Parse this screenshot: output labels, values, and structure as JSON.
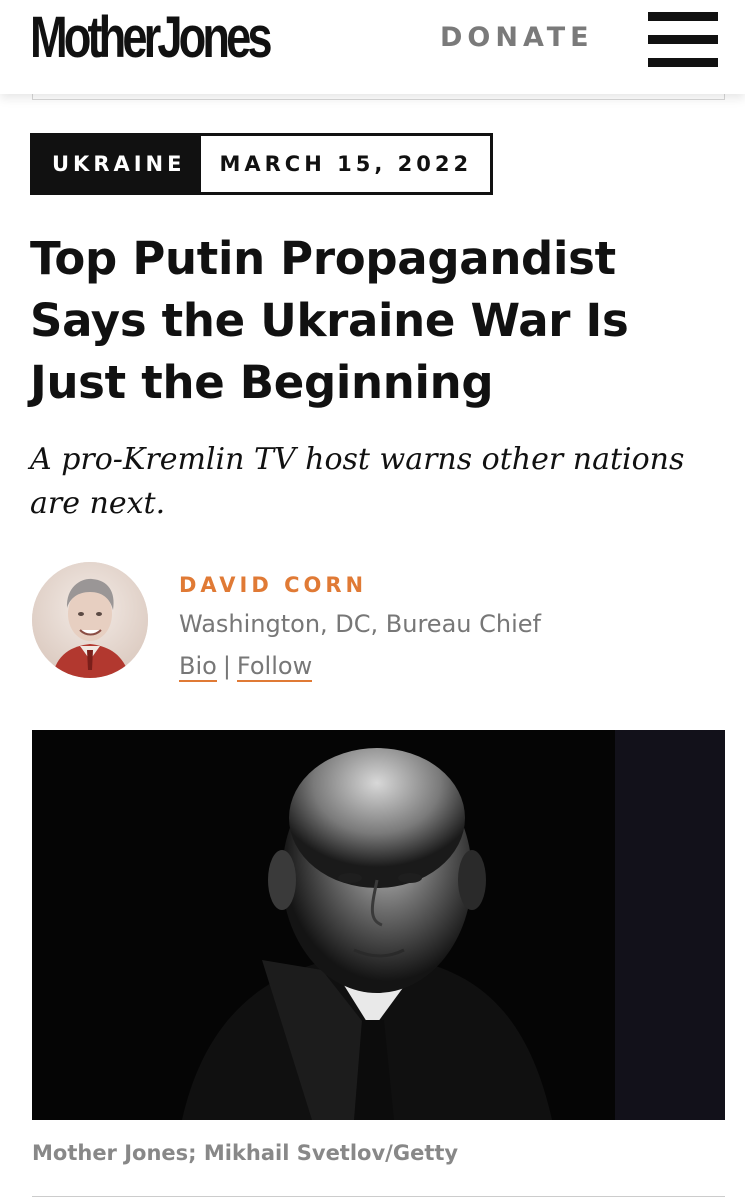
{
  "header": {
    "logo_text": "MotherJones",
    "donate_label": "DONATE",
    "menu_icon": "hamburger-menu-icon"
  },
  "article": {
    "category": "UKRAINE",
    "date": "MARCH 15, 2022",
    "headline": "Top Putin Propagandist Says the Ukraine War Is Just the Beginning",
    "dek": "A pro-Kremlin TV host warns other nations are next."
  },
  "author": {
    "name": "DAVID CORN",
    "title": "Washington, DC, Bureau Chief",
    "bio_link": "Bio",
    "separator": "|",
    "follow_link": "Follow"
  },
  "image": {
    "caption": "Mother Jones; Mikhail Svetlov/Getty"
  },
  "colors": {
    "accent": "#e07a35",
    "text": "#111111",
    "muted": "#777777"
  }
}
